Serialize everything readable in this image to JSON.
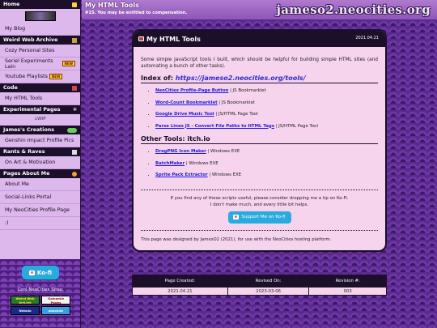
{
  "sidebar": {
    "home_label": "Home",
    "sections": [
      {
        "id": "home",
        "label": "Home",
        "items": [
          {
            "label": "My Blog"
          }
        ]
      },
      {
        "id": "weird",
        "label": "Weird Web Archive",
        "items": [
          {
            "label": "Cozy Personal Sites"
          },
          {
            "label": "Seriel Experiments Lain",
            "badge": "NEW"
          },
          {
            "label": "Youtube Playlists",
            "badge": "NEW"
          }
        ]
      },
      {
        "id": "code",
        "label": "Code",
        "items": [
          {
            "label": "My HTML Tools"
          }
        ]
      },
      {
        "id": "exp",
        "label": "Experimental Pages",
        "items": [
          {
            "label": "WIP"
          }
        ]
      },
      {
        "id": "creations",
        "label": "James's Creations",
        "items": [
          {
            "label": "Genshin Impact Profile Pics"
          }
        ]
      },
      {
        "id": "rants",
        "label": "Rants & Raves",
        "items": [
          {
            "label": "On Art & Motivation"
          }
        ]
      },
      {
        "id": "about",
        "label": "Pages About Me",
        "items": [
          {
            "label": "About Me"
          },
          {
            "label": "Social-Links Portal"
          },
          {
            "label": "My NeoCities Profile Page"
          },
          {
            "label": ":)"
          }
        ]
      }
    ],
    "kofi_label": "Ko-fi",
    "cool_title": "Cool NeoCities Sites:",
    "cool_sites": [
      "Weird Web ArtLink",
      "Gamamie Pages",
      "Nebula",
      "absolute"
    ]
  },
  "header": {
    "title": "My HTML Tools",
    "subtitle": "#15. You may be entitled to compensation.",
    "site_logo": "jameso2.neocities.org"
  },
  "card": {
    "title": "My HTML Tools",
    "date": "2021.04.21",
    "intro": "Some simple JavaScript tools I built, which should be helpful for building simple HTML sites (and automating a bunch of other tasks).",
    "index_label": "Index of:",
    "index_link": "https://jameso2.neocities.org/tools/",
    "js_tools": [
      {
        "name": "NeoCities Profile-Page Button",
        "type": "| JS Bookmarklet"
      },
      {
        "name": "Word-Count Bookmarklet",
        "type": "| JS Bookmarklet"
      },
      {
        "name": "Google Drive Music Tool",
        "type": "| JS/HTML Page Tool"
      },
      {
        "name": "Parse Lines JS - Convert File Paths to HTML Tags",
        "type": "| JS/HTML Page Tool"
      }
    ],
    "other_title": "Other Tools: itch.io",
    "other_tools": [
      {
        "name": "DragPNG Icon Maker",
        "type": "| Windows EXE"
      },
      {
        "name": "BatchMaker",
        "type": "| Windows EXE"
      },
      {
        "name": "Sprite Pack Extractor",
        "type": "| Windows EXE"
      }
    ],
    "tip_line1": "If you find any of these scripts useful, please consider dropping me a tip on Ko-Fi.",
    "tip_line2": "I don't make much, and every little bit helps.",
    "kofi_button": "Support Me on Ko-fi",
    "footer": "This page was designed by JamesO2 (2021), for use with the NeoCities hosting platform."
  },
  "info_table": {
    "headers": [
      "Page Created:",
      "Revised On:",
      "Revision #:"
    ],
    "values": [
      "2021.04.21",
      "2023-03-06",
      "003"
    ]
  }
}
